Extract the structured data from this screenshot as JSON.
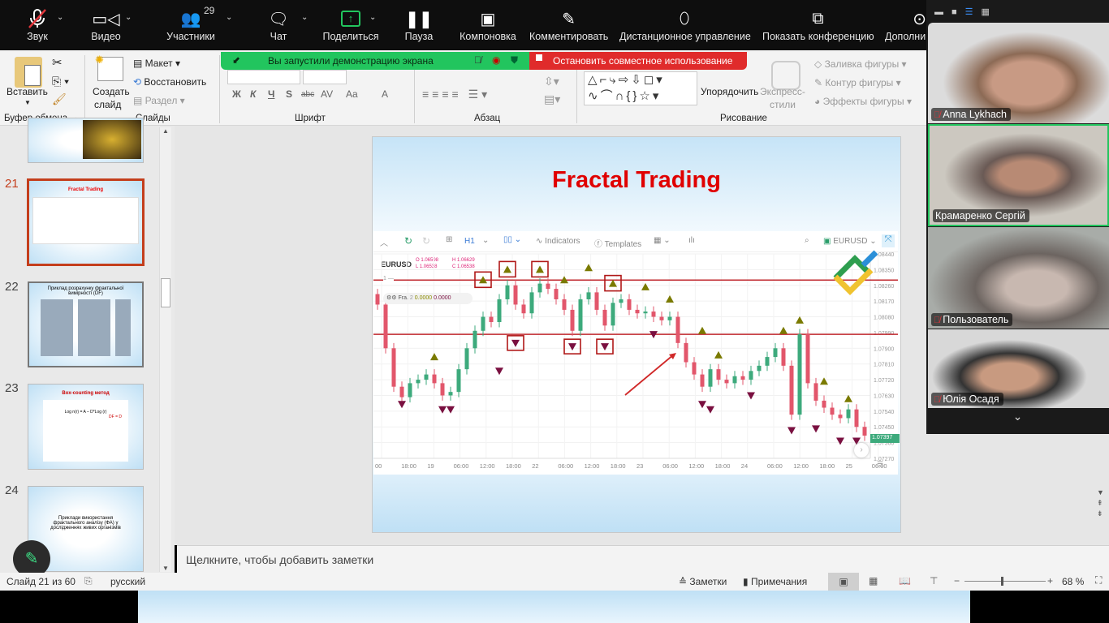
{
  "zoom_toolbar": {
    "items": [
      {
        "label": "Звук",
        "icon": "mic-muted-icon"
      },
      {
        "label": "Видео",
        "icon": "video-icon"
      },
      {
        "label": "Участники",
        "icon": "participants-icon",
        "badge": "29"
      },
      {
        "label": "Чат",
        "icon": "chat-icon"
      },
      {
        "label": "Поделиться",
        "icon": "share-screen-icon"
      },
      {
        "label": "Пауза",
        "icon": "pause-icon"
      },
      {
        "label": "Компоновка",
        "icon": "layout-icon"
      },
      {
        "label": "Комментировать",
        "icon": "annotate-pen-icon"
      },
      {
        "label": "Дистанционное управление",
        "icon": "mouse-icon"
      },
      {
        "label": "Показать конференцию",
        "icon": "show-meeting-icon"
      },
      {
        "label": "Дополни",
        "icon": "more-icon"
      }
    ]
  },
  "share_banner": {
    "text": "Вы запустили демонстрацию экрана",
    "stop": "Остановить совместное использование"
  },
  "ribbon": {
    "clipboard": {
      "paste": "Вставить",
      "group": "Буфер обмена"
    },
    "slides": {
      "new_slide_1": "Создать",
      "new_slide_2": "слайд",
      "layout": "Макет",
      "reset": "Восстановить",
      "section": "Раздел",
      "group": "Слайды"
    },
    "font": {
      "group": "Шрифт",
      "bold": "Ж",
      "italic": "К",
      "underline": "Ч",
      "shadow": "S",
      "strike": "abc",
      "spacing": "AV",
      "case": "Aa",
      "color": "A"
    },
    "paragraph": {
      "group": "Абзац"
    },
    "drawing": {
      "arrange": "Упорядочить",
      "quick_styles_1": "Экспресс-",
      "quick_styles_2": "стили",
      "fill": "Заливка фигуры",
      "outline": "Контур фигуры",
      "effects": "Эффекты фигуры",
      "group": "Рисование"
    }
  },
  "thumbnails": [
    {
      "num": "21",
      "title": "Fractal Trading",
      "active": true
    },
    {
      "num": "22",
      "title": "Приклад розрахунку фрактальної вимірності (DF)"
    },
    {
      "num": "23",
      "title": "Box-counting метод",
      "formula": "Log n(r) = A – D*Log (r)",
      "df": "DF = D"
    },
    {
      "num": "24",
      "title": "Приклади використання фрактального аналізу (ФА) у дослідженнях живих організмів"
    }
  ],
  "slide": {
    "title": "Fractal Trading",
    "title_color": "#e00000"
  },
  "chart_toolbar": {
    "timeframe": "H1",
    "indicators": "Indicators",
    "templates": "Templates",
    "symbol": "EURUSD"
  },
  "chart_data": {
    "type": "candlestick",
    "symbol": "EURUSD",
    "ohlc": {
      "o": "O 1.06598",
      "h": "H 1.06629",
      "l": "L 1.06538",
      "c": "C 1.06538"
    },
    "indicator": {
      "name": "Fra.",
      "period": "2",
      "v1": "0.0000",
      "v2": "0.0000"
    },
    "line_label": "1 —",
    "ylim": [
      1.0727,
      1.0844
    ],
    "yticks": [
      "1.08440",
      "1.08350",
      "1.08260",
      "1.08170",
      "1.08080",
      "1.07990",
      "1.07900",
      "1.07810",
      "1.07720",
      "1.07630",
      "1.07540",
      "1.07450",
      "1.07360",
      "1.07270"
    ],
    "current_price": "1.07397",
    "xticks": [
      "00",
      "18:00",
      "19",
      "06:00",
      "12:00",
      "18:00",
      "22",
      "06:00",
      "12:00",
      "18:00",
      "23",
      "06:00",
      "12:00",
      "18:00",
      "24",
      "06:00",
      "12:00",
      "18:00",
      "25",
      "06:00"
    ],
    "closes": [
      1.0815,
      1.079,
      1.0768,
      1.0762,
      1.077,
      1.0772,
      1.0775,
      1.077,
      1.0763,
      1.0765,
      1.0778,
      1.079,
      1.08,
      1.0808,
      1.0805,
      1.0818,
      1.0826,
      1.0815,
      1.081,
      1.0822,
      1.0827,
      1.0824,
      1.0818,
      1.0812,
      1.08,
      1.0818,
      1.0822,
      1.0812,
      1.0803,
      1.0816,
      1.0818,
      1.0812,
      1.081,
      1.0811,
      1.0808,
      1.0806,
      1.0808,
      1.0793,
      1.0782,
      1.0775,
      1.0768,
      1.0778,
      1.0772,
      1.077,
      1.0774,
      1.0772,
      1.0777,
      1.078,
      1.0785,
      1.079,
      1.078,
      1.0752,
      1.0798,
      1.077,
      1.076,
      1.0756,
      1.0752,
      1.075,
      1.0755,
      1.0745,
      1.074
    ],
    "horizontal_lines": [
      1.0829,
      1.0798
    ],
    "fractals_up": [
      {
        "i": 7,
        "p": 1.0785
      },
      {
        "i": 13,
        "p": 1.0829,
        "boxed": true
      },
      {
        "i": 16,
        "p": 1.0835,
        "boxed": true
      },
      {
        "i": 20,
        "p": 1.0835,
        "boxed": true
      },
      {
        "i": 23,
        "p": 1.0829
      },
      {
        "i": 26,
        "p": 1.0836
      },
      {
        "i": 29,
        "p": 1.0827,
        "boxed": true
      },
      {
        "i": 33,
        "p": 1.0825
      },
      {
        "i": 36,
        "p": 1.0818
      },
      {
        "i": 40,
        "p": 1.08
      },
      {
        "i": 42,
        "p": 1.0786
      },
      {
        "i": 50,
        "p": 1.08
      },
      {
        "i": 52,
        "p": 1.0806
      },
      {
        "i": 55,
        "p": 1.0771
      },
      {
        "i": 58,
        "p": 1.0761
      }
    ],
    "fractals_down": [
      {
        "i": 3,
        "p": 1.0758
      },
      {
        "i": 8,
        "p": 1.0755
      },
      {
        "i": 9,
        "p": 1.0755
      },
      {
        "i": 15,
        "p": 1.0777
      },
      {
        "i": 17,
        "p": 1.0793,
        "boxed": true
      },
      {
        "i": 24,
        "p": 1.0791,
        "boxed": true
      },
      {
        "i": 28,
        "p": 1.0791,
        "boxed": true
      },
      {
        "i": 34,
        "p": 1.0798
      },
      {
        "i": 40,
        "p": 1.0758
      },
      {
        "i": 41,
        "p": 1.0755
      },
      {
        "i": 46,
        "p": 1.0763
      },
      {
        "i": 51,
        "p": 1.0743
      },
      {
        "i": 54,
        "p": 1.0744
      },
      {
        "i": 57,
        "p": 1.0737
      },
      {
        "i": 59,
        "p": 1.0737
      }
    ],
    "colors": {
      "up": "#3daa7c",
      "down": "#e2566b",
      "fractal_up": "#7a7a00",
      "fractal_down": "#7a1040",
      "lines": "#c0282e"
    }
  },
  "notes_placeholder": "Щелкните, чтобы добавить заметки",
  "status": {
    "slide": "Слайд 21 из 60",
    "lang": "русский",
    "notes": "Заметки",
    "comments": "Примечания",
    "zoom": "68 %",
    "zoom_fraction": 0.45
  },
  "participants": [
    {
      "name": "Anna Lykhach",
      "muted": true
    },
    {
      "name": "Крамаренко Сергій",
      "muted": false,
      "active": true
    },
    {
      "name": "Пользователь",
      "muted": true
    },
    {
      "name": "Юлія Осадя",
      "muted": true
    }
  ]
}
